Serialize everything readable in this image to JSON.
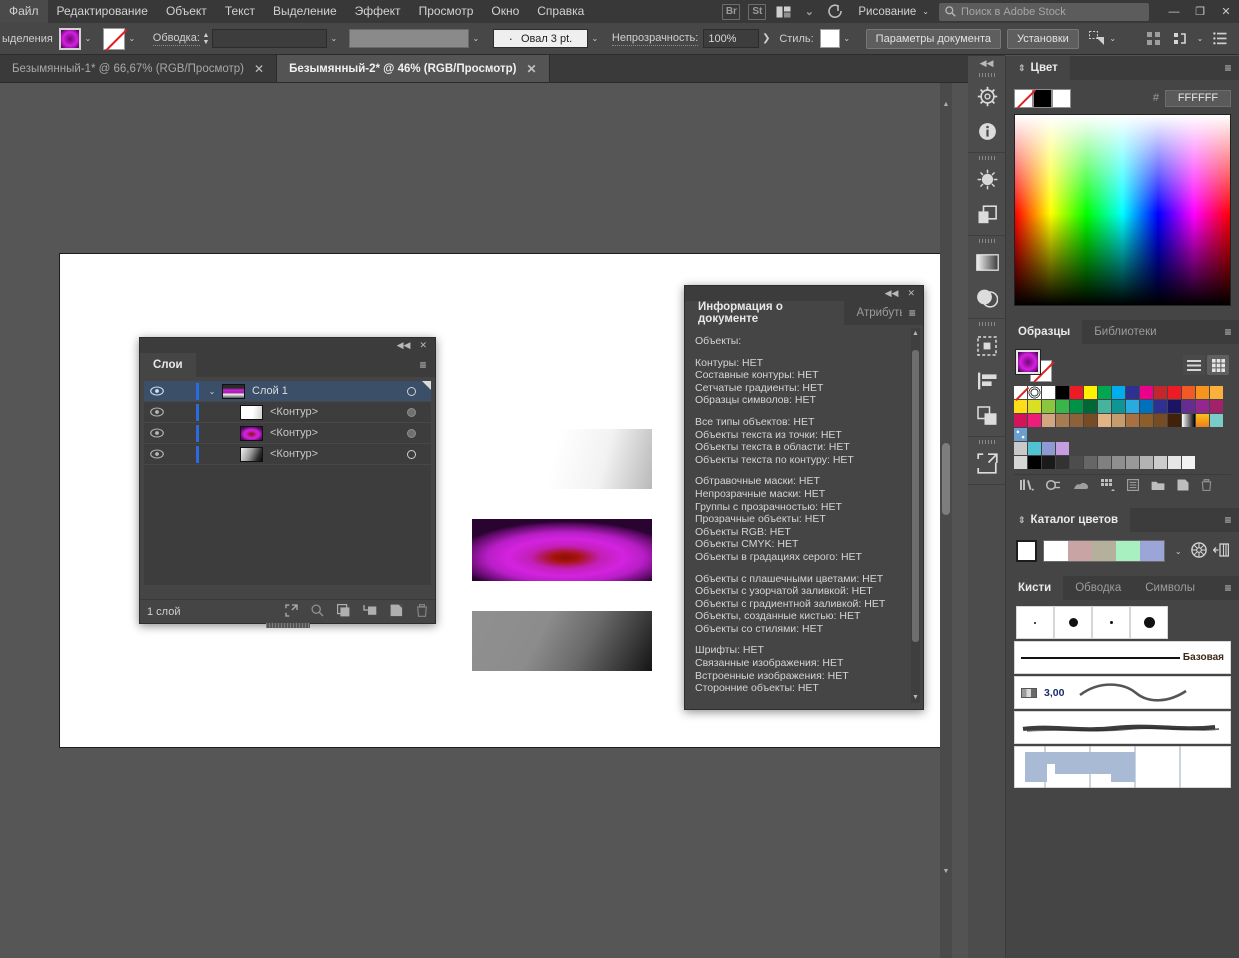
{
  "app": {
    "menu": [
      "Файл",
      "Редактирование",
      "Объект",
      "Текст",
      "Выделение",
      "Эффект",
      "Просмотр",
      "Окно",
      "Справка"
    ],
    "bridge_label": "Br",
    "stock_label": "St",
    "workspace": "Рисование",
    "search_placeholder": "Поиск в Adobe Stock",
    "window_minimize": "—",
    "window_restore": "❐",
    "window_close": "✕"
  },
  "control_bar": {
    "selection_label": "ыделения",
    "stroke_label": "Обводка:",
    "stroke_weight": "",
    "profile_value": "",
    "brush_value": "Овал 3 pt.",
    "opacity_label": "Непрозрачность:",
    "opacity_value": "100%",
    "style_label": "Стиль:",
    "doc_setup_button": "Параметры документа",
    "preferences_button": "Установки"
  },
  "tabs": [
    {
      "title": "Безымянный-1* @ 66,67% (RGB/Просмотр)",
      "active": false,
      "close": "✕"
    },
    {
      "title": "Безымянный-2* @ 46% (RGB/Просмотр)",
      "active": true,
      "close": "✕"
    }
  ],
  "layers_panel": {
    "tab_label": "Слои",
    "collapse": "◀◀",
    "close": "✕",
    "menu": "≡",
    "footer_count": "1 слой",
    "rows": [
      {
        "name": "Слой 1",
        "selected": true,
        "thumb": "g-layer",
        "expand": "⌄",
        "has_arrow": true,
        "target": "open"
      },
      {
        "name": "<Контур>",
        "selected": false,
        "thumb": "g-white",
        "expand": "",
        "has_arrow": false,
        "target": "dim"
      },
      {
        "name": "<Контур>",
        "selected": false,
        "thumb": "g-mag",
        "expand": "",
        "has_arrow": false,
        "target": "dim"
      },
      {
        "name": "<Контур>",
        "selected": false,
        "thumb": "g-gray",
        "expand": "",
        "has_arrow": false,
        "target": "open"
      }
    ],
    "footer_icons": [
      "locate-object-icon",
      "search-icon",
      "make-clipping-mask-icon",
      "create-sublayer-icon",
      "create-new-layer-icon",
      "delete-layer-icon"
    ]
  },
  "docinfo_panel": {
    "tab_active": "Информация о документе",
    "tab_inactive": "Атрибуты",
    "collapse": "◀◀",
    "close": "✕",
    "menu": "≡",
    "heading": "Объекты:",
    "groups": [
      [
        "Контуры: НЕТ",
        "Составные контуры: НЕТ",
        "Сетчатые градиенты: НЕТ",
        "Образцы символов: НЕТ"
      ],
      [
        "Все типы объектов: НЕТ",
        "Объекты текста из точки: НЕТ",
        "Объекты текста в области: НЕТ",
        "Объекты текста по контуру: НЕТ"
      ],
      [
        "Обтравочные маски: НЕТ",
        "Непрозрачные маски: НЕТ",
        "Группы с прозрачностью: НЕТ",
        "Прозрачные объекты: НЕТ",
        "Объекты RGB: НЕТ",
        "Объекты CMYK: НЕТ",
        "Объекты в градациях серого: НЕТ"
      ],
      [
        "Объекты с плашечными цветами: НЕТ",
        "Объекты с узорчатой заливкой: НЕТ",
        "Объекты с градиентной заливкой: НЕТ",
        "Объекты, созданные кистью: НЕТ",
        "Объекты со стилями: НЕТ"
      ],
      [
        "Шрифты: НЕТ",
        "Связанные изображения: НЕТ",
        "Встроенные изображения: НЕТ",
        "Сторонние объекты: НЕТ"
      ]
    ]
  },
  "dock": {
    "collapse": "◀◀",
    "groups": [
      [
        "transform-icon",
        "info-icon"
      ],
      [
        "appearance-icon",
        "pathfinder-icon"
      ],
      [
        "gradient-icon",
        "transparency-icon"
      ],
      [
        "artboards-icon",
        "align-icon",
        "layers-stack-icon"
      ],
      [
        "export-icon"
      ]
    ]
  },
  "color_panel": {
    "tab_label": "Цвет",
    "collapse": "⇕",
    "menu": "≡",
    "hash": "#",
    "hex_value": "FFFFFF",
    "none_swatch": "none-swatch",
    "black_swatch": "#000000",
    "white_swatch": "#FFFFFF"
  },
  "swatches_panel": {
    "tab_active": "Образцы",
    "tab_inactive": "Библиотеки",
    "menu": "≡",
    "view_list_icon": "list-view-icon",
    "view_grid_icon": "grid-view-icon",
    "grid": [
      [
        "none",
        "reg",
        "#ffffff",
        "#000000",
        "#ed1c24",
        "#fff200",
        "#00a650",
        "#00aeef",
        "#2e3192",
        "#ec008c",
        "#c1272d",
        "#ed1c24",
        "#f15a24",
        "#f7941e",
        "#fbb03b"
      ],
      [
        "#ffde17",
        "#d9e021",
        "#8cc63f",
        "#39b54a",
        "#009245",
        "#006837",
        "#45b39d",
        "#0e9594",
        "#29abe2",
        "#0071bc",
        "#2e3192",
        "#1b1464",
        "#662d91",
        "#93278f",
        "#a1216b"
      ],
      [
        "#d4145a",
        "#ed1e79",
        "#d3a580",
        "#a67c52",
        "#8c6239",
        "#754c24",
        "#e3b383",
        "#c69c6d",
        "#a97142",
        "#8c5e2a",
        "#754c24",
        "#42210b",
        "gradient-white-black",
        "gradient-orange",
        "#7accc8"
      ],
      [
        "pattern-snow"
      ],
      [
        "#c9c9c9",
        "#4fc3d1",
        "#8e9ad4",
        "#c49ee0"
      ],
      [
        "#d6d6d6",
        "#000000",
        "#1a1a1a",
        "#333333",
        "#4d4d4d",
        "#666666",
        "#808080",
        "#8f8f8f",
        "#999999",
        "#b3b3b3",
        "#cccccc",
        "#e6e6e6",
        "#f2f2f2"
      ]
    ],
    "footer_icons": [
      "swatch-libraries-icon",
      "color-group-icon",
      "show-libraries-icon",
      "swatch-kinds-icon",
      "swatch-options-icon",
      "new-color-group-icon",
      "new-swatch-icon",
      "delete-swatch-icon"
    ]
  },
  "color_guide_panel": {
    "tab_label": "Каталог цветов",
    "collapse": "⇕",
    "menu": "≡",
    "base_color": "#FFFFFF",
    "harmony_colors": [
      "#ffffff",
      "#c9a4a4",
      "#b5b09b",
      "#a8f0c0",
      "#9ba5d8"
    ],
    "dropdown": "⌄",
    "edit_colors_icon": "color-wheel-icon",
    "save_group_icon": "save-group-icon"
  },
  "brushes_panel": {
    "tabs": [
      "Кисти",
      "Обводка",
      "Символы"
    ],
    "menu": "≡",
    "active_tab": "Кисти",
    "basic_label": "Базовая",
    "width_value": "3,00",
    "dots": [
      2,
      9,
      3,
      11
    ]
  }
}
